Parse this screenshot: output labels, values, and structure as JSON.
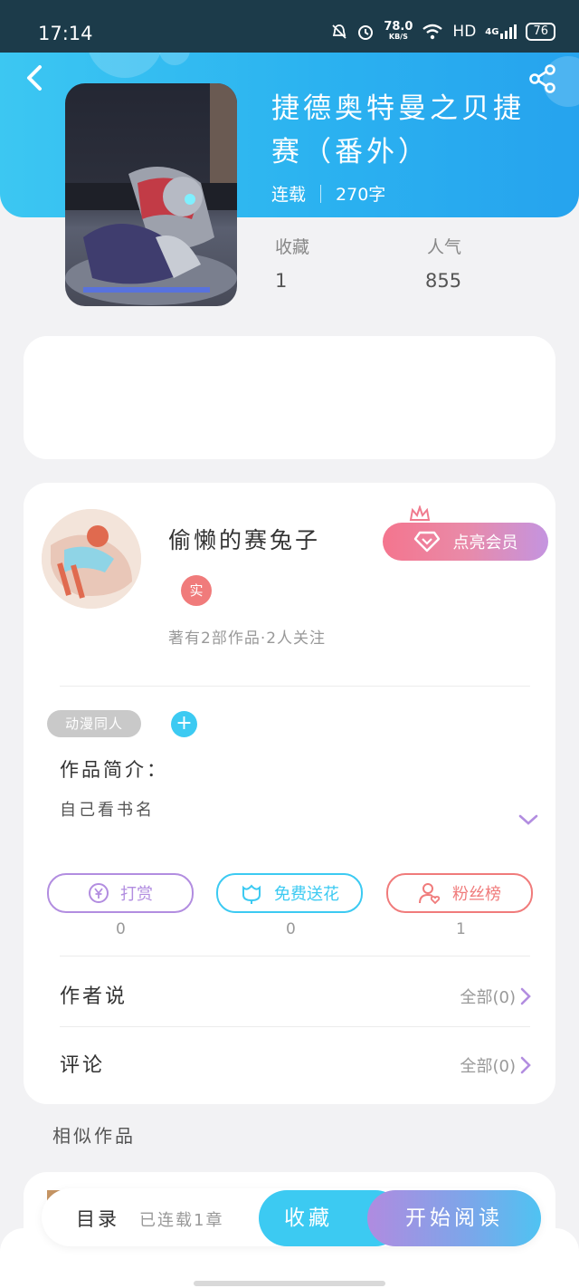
{
  "status_bar": {
    "time": "17:14",
    "speed_value": "78.0",
    "speed_unit": "KB/S",
    "network": "HD",
    "signal": "4G",
    "battery": "76"
  },
  "book": {
    "title": "捷德奥特曼之贝捷赛（番外）",
    "status": "连载",
    "word_count": "270字",
    "favorites_label": "收藏",
    "favorites_value": "1",
    "popularity_label": "人气",
    "popularity_value": "855"
  },
  "author": {
    "name": "偷懒的赛兔子",
    "verified_badge": "实",
    "stats": "著有2部作品·2人关注",
    "vip_button": "点亮会员"
  },
  "intro": {
    "tag": "动漫同人",
    "add_tag": "+",
    "label": "作品简介：",
    "text": "自己看书名"
  },
  "actions": [
    {
      "label": "打赏",
      "count": "0",
      "color": "#b28de0"
    },
    {
      "label": "免费送花",
      "count": "0",
      "color": "#3ccaf2"
    },
    {
      "label": "粉丝榜",
      "count": "1",
      "color": "#f07b7b"
    }
  ],
  "sections": {
    "author_says": "作者说",
    "author_says_all": "全部(0)",
    "comments": "评论",
    "comments_all": "全部(0)",
    "similar": "相似作品"
  },
  "bottom": {
    "toc": "目录",
    "toc_status": "已连载1章",
    "favorite": "收藏",
    "start_reading": "开始阅读"
  },
  "colors": {
    "accent_blue": "#3ccaf2",
    "accent_purple": "#b28de0",
    "accent_red": "#f07b7b"
  }
}
